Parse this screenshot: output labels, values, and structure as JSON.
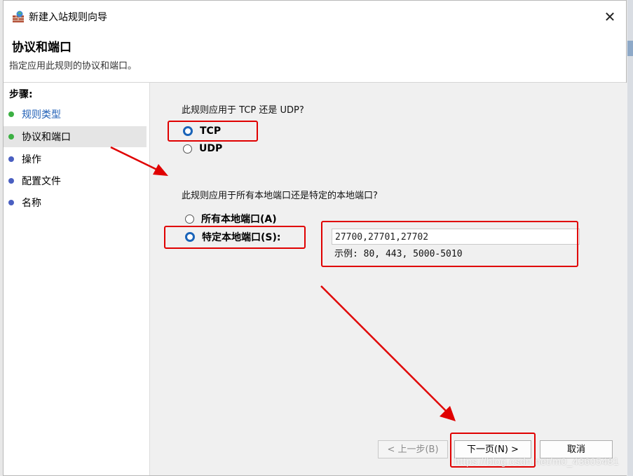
{
  "window": {
    "title": "新建入站规则向导",
    "close_glyph": "✕",
    "app_icon": "firewall-brick-globe-icon"
  },
  "header": {
    "title": "协议和端口",
    "subtitle": "指定应用此规则的协议和端口。"
  },
  "sidebar": {
    "heading": "步骤:",
    "items": [
      {
        "label": "规则类型",
        "status": "done"
      },
      {
        "label": "协议和端口",
        "status": "current"
      },
      {
        "label": "操作",
        "status": "pending"
      },
      {
        "label": "配置文件",
        "status": "pending"
      },
      {
        "label": "名称",
        "status": "pending"
      }
    ],
    "colors": {
      "done": "#3cb043",
      "pending": "#4a5fc1",
      "link": "#1f5fb6"
    }
  },
  "protocol": {
    "question": "此规则应用于 TCP 还是 UDP?",
    "options": [
      {
        "label": "TCP",
        "selected": true
      },
      {
        "label": "UDP",
        "selected": false
      }
    ]
  },
  "ports": {
    "question": "此规则应用于所有本地端口还是特定的本地端口?",
    "options": [
      {
        "label": "所有本地端口(A)",
        "selected": false
      },
      {
        "label": "特定本地端口(S):",
        "selected": true
      }
    ],
    "value": "27700,27701,27702",
    "example": "示例: 80, 443, 5000-5010"
  },
  "buttons": {
    "back": "< 上一步(B)",
    "next": "下一页(N) >",
    "cancel": "取消"
  },
  "annotation_color": "#e00000",
  "watermark": "https://blog.csdn.net/m0_43605481"
}
